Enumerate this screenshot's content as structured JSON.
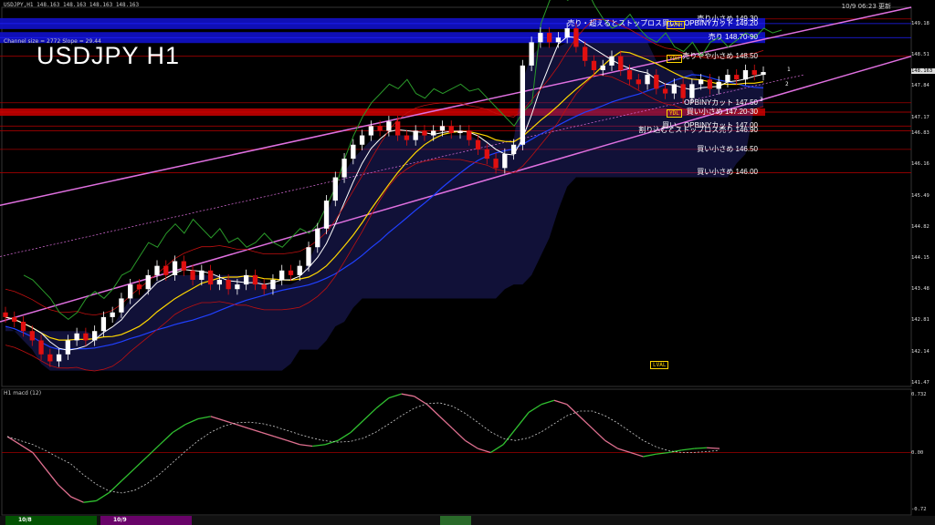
{
  "header": {
    "quote": "USDJPY,H1 148.163 148.163 148.163 148.163",
    "channel_info": "Channel size = 2772  Slope = 29.44",
    "symbol": "USDJPY H1",
    "datetime": "10/9 06:23 更新",
    "macd_label": "H1 macd (12)"
  },
  "levels": [
    {
      "price": 149.3,
      "label": "売り小さめ 149.30",
      "color": "#ffffff"
    },
    {
      "price": 149.2,
      "label": "売り・超えるとストップロス買い、OPBINYカット 149.20",
      "color": "#2020ff"
    },
    {
      "price": 148.9,
      "label": "売り 148.70-90",
      "color": "#2020ff"
    },
    {
      "price": 148.5,
      "label": "売りやや小さめ 148.50",
      "color": "#ffffff"
    },
    {
      "price": 147.5,
      "label": "OPBINYカット 147.50",
      "color": "#ffffff"
    },
    {
      "price": 147.3,
      "label": "買い小さめ 147.20-30",
      "color": "#d00000"
    },
    {
      "price": 147.0,
      "label": "買い、OPBINYカット 147.00",
      "color": "#ffffff"
    },
    {
      "price": 146.9,
      "label": "割り込むとストップロス売り 146.90",
      "color": "#ffffff"
    },
    {
      "price": 146.5,
      "label": "買い小さめ 146.50",
      "color": "#ffffff"
    },
    {
      "price": 146.0,
      "label": "買い小さめ 146.00",
      "color": "#ffffff"
    }
  ],
  "tags": [
    {
      "text": "LVMH",
      "price": 149.18,
      "color": "#ffd700"
    },
    {
      "text": "YDH",
      "price": 148.45,
      "color": "#ffd700"
    },
    {
      "text": "YDL",
      "price": 147.28,
      "color": "#ffd700"
    },
    {
      "text": "LVAL",
      "price": 141.88,
      "color": "#ffd700"
    }
  ],
  "markers": [
    "1",
    "2",
    "3"
  ],
  "axis": {
    "price_ticks": [
      149.18,
      148.51,
      148.163,
      147.84,
      147.17,
      146.83,
      146.16,
      145.49,
      144.82,
      144.15,
      143.48,
      142.81,
      142.14,
      141.47
    ],
    "macd_ticks": [
      "0.732",
      "0.00",
      "-0.72"
    ],
    "price_range": [
      141.45,
      149.55
    ]
  },
  "timeframes": [
    {
      "label": "10/8",
      "color": "#006400"
    },
    {
      "label": "10/9",
      "color": "#800080"
    }
  ],
  "chart_data": {
    "type": "candlestick",
    "symbol": "USDJPY",
    "timeframe": "H1",
    "close": [
      142.9,
      142.8,
      142.6,
      142.4,
      142.1,
      141.95,
      142.1,
      142.4,
      142.55,
      142.4,
      142.6,
      142.9,
      143.0,
      143.3,
      143.6,
      143.5,
      143.8,
      144.0,
      143.8,
      144.1,
      143.9,
      143.7,
      143.9,
      143.6,
      143.7,
      143.5,
      143.6,
      143.8,
      143.6,
      143.5,
      143.7,
      143.9,
      143.8,
      144.0,
      144.4,
      144.8,
      145.4,
      145.9,
      146.3,
      146.6,
      146.8,
      147.0,
      146.9,
      147.1,
      146.8,
      146.7,
      146.9,
      146.8,
      146.9,
      147.0,
      146.85,
      146.9,
      146.7,
      146.5,
      146.3,
      146.1,
      146.4,
      146.6,
      148.3,
      148.8,
      149.0,
      148.8,
      148.9,
      149.1,
      148.7,
      148.4,
      148.2,
      148.3,
      148.5,
      148.2,
      148.0,
      147.9,
      148.1,
      147.8,
      147.7,
      147.9,
      147.6,
      147.9,
      148.0,
      147.8,
      147.95,
      148.1,
      148.0,
      148.2,
      148.1,
      148.16
    ],
    "macd": [
      0.2,
      0.1,
      0.0,
      -0.2,
      -0.4,
      -0.55,
      -0.62,
      -0.6,
      -0.5,
      -0.35,
      -0.2,
      -0.05,
      0.1,
      0.25,
      0.35,
      0.42,
      0.45,
      0.4,
      0.35,
      0.3,
      0.25,
      0.2,
      0.15,
      0.1,
      0.08,
      0.1,
      0.15,
      0.25,
      0.4,
      0.55,
      0.68,
      0.73,
      0.7,
      0.6,
      0.45,
      0.3,
      0.15,
      0.05,
      0.0,
      0.1,
      0.3,
      0.5,
      0.6,
      0.65,
      0.6,
      0.45,
      0.3,
      0.15,
      0.05,
      0.0,
      -0.05,
      -0.02,
      0.0,
      0.03,
      0.05,
      0.06,
      0.05
    ],
    "price_range": [
      141.45,
      149.55
    ],
    "macd_range": [
      -0.72,
      0.732
    ]
  }
}
